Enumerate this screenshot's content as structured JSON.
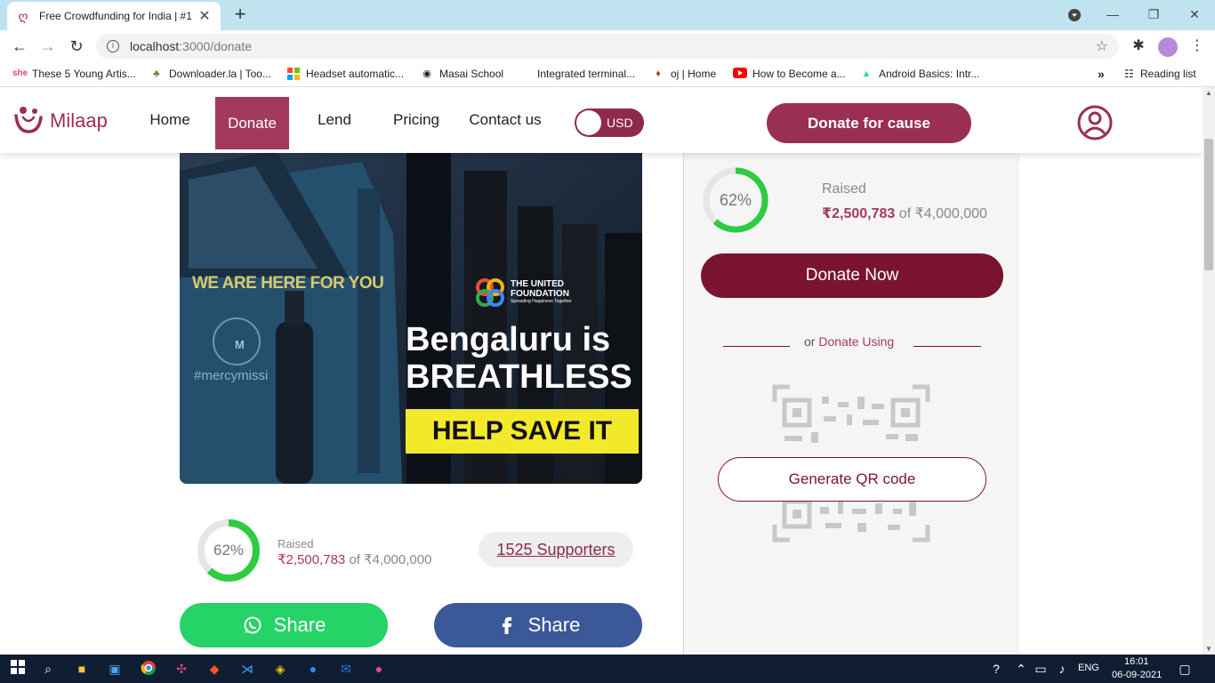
{
  "browser": {
    "tab_title": "Free Crowdfunding for India | #1",
    "url_host": "localhost",
    "url_rest": ":3000/donate",
    "bookmarks": [
      "These 5 Young Artis...",
      "Downloader.la | Too...",
      "Headset automatic...",
      "Masai School",
      "Integrated terminal...",
      "oj | Home",
      "How to Become a...",
      "Android Basics: Intr..."
    ],
    "reading_list": "Reading list",
    "more": "»"
  },
  "navbar": {
    "logo_text": "Milaap",
    "items": [
      "Home",
      "Donate",
      "Lend",
      "Pricing",
      "Contact us"
    ],
    "active_item": "Donate",
    "currency_toggle": "USD",
    "cta": "Donate for cause"
  },
  "banner": {
    "sign_text": "WE ARE HERE FOR YOU",
    "hashtag": "#mercymissi",
    "org_line1": "THE UNITED",
    "org_line2": "FOUNDATION",
    "org_tagline": "Spreading Happiness Together",
    "headline_1": "Bengaluru is",
    "headline_2": "BREATHLESS",
    "help": "HELP SAVE IT"
  },
  "stats": {
    "percent": 62,
    "percent_label": "62%",
    "raised_label": "Raised",
    "raised_amount": "₹2,500,783",
    "of": "of",
    "goal": "₹4,000,000",
    "supporters": "1525 Supporters"
  },
  "share": {
    "whatsapp_label": "Share",
    "facebook_label": "Share"
  },
  "panel": {
    "donate_now": "Donate Now",
    "or_text": "or",
    "donate_using": "Donate Using",
    "generate_qr": "Generate QR code"
  },
  "taskbar": {
    "lang": "ENG",
    "time": "16:01",
    "date": "06-09-2021"
  },
  "colors": {
    "brand": "#9a2f51",
    "brand_dark": "#7a1430",
    "progress": "#2ecc40",
    "whatsapp": "#25d366",
    "facebook": "#3b5998"
  }
}
